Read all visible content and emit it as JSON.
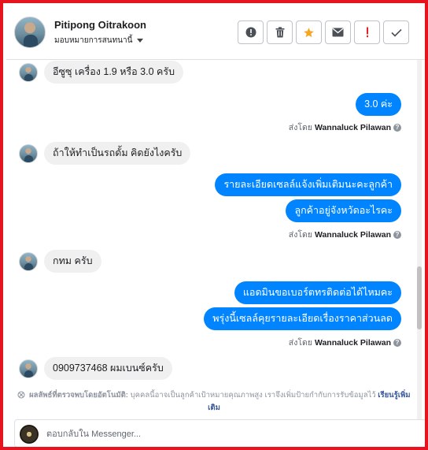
{
  "header": {
    "contact_name": "Pitipong Oitrakoon",
    "assign_label": "มอบหมายการสนทนานี้",
    "actions": [
      {
        "name": "info-button",
        "icon": "exclamation-circle-icon"
      },
      {
        "name": "delete-button",
        "icon": "trash-icon"
      },
      {
        "name": "star-button",
        "icon": "star-icon",
        "color": "#f5a623"
      },
      {
        "name": "mark-unread-button",
        "icon": "envelope-icon"
      },
      {
        "name": "spam-button",
        "icon": "exclamation-icon",
        "color": "#e02424"
      },
      {
        "name": "mark-done-button",
        "icon": "checkmark-icon"
      }
    ]
  },
  "messages": {
    "m1": "อีซูซุ เครื่อง 1.9 หรือ 3.0 ครับ",
    "m2": "3.0  ค่ะ",
    "m3": "ถ้าให้ทำเป็นรถดั้ม คิดยังไงครับ",
    "m4": "รายละเอียดเซลล์แจ้งเพิ่มเติมนะคะลูกค้า",
    "m5": "ลูกค้าอยู่จังหวัดอะไรคะ",
    "m6": "กทม ครับ",
    "m7": "แอดมินขอเบอร์ตทรติดต่อได้ไหมคะ",
    "m8": "พรุ่งนี้เซลล์คุยรายละเอียดเรื่องราคาส่วนลด",
    "m9": "0909737468 ผมเบนซ์ครับ"
  },
  "sent_by": {
    "prefix": "ส่งโดย",
    "agent": "Wannaluck Pilawan"
  },
  "notice": {
    "bold_text": "ผลลัพธ์ที่ตรวจพบโดยอัตโนมัติ:",
    "body_text": " บุคคลนี้อาจเป็นลูกค้าเป้าหมายคุณภาพสูง เราจึงเพิ่มป้ายกำกับการรับข้อมูลไว้ ",
    "link_text": "เรียนรู้เพิ่มเติม"
  },
  "composer": {
    "placeholder": "ตอบกลับใน Messenger..."
  },
  "colors": {
    "frame_border": "#e5141e",
    "outgoing_bubble": "#0084ff",
    "incoming_bubble": "#f1f0f0"
  }
}
